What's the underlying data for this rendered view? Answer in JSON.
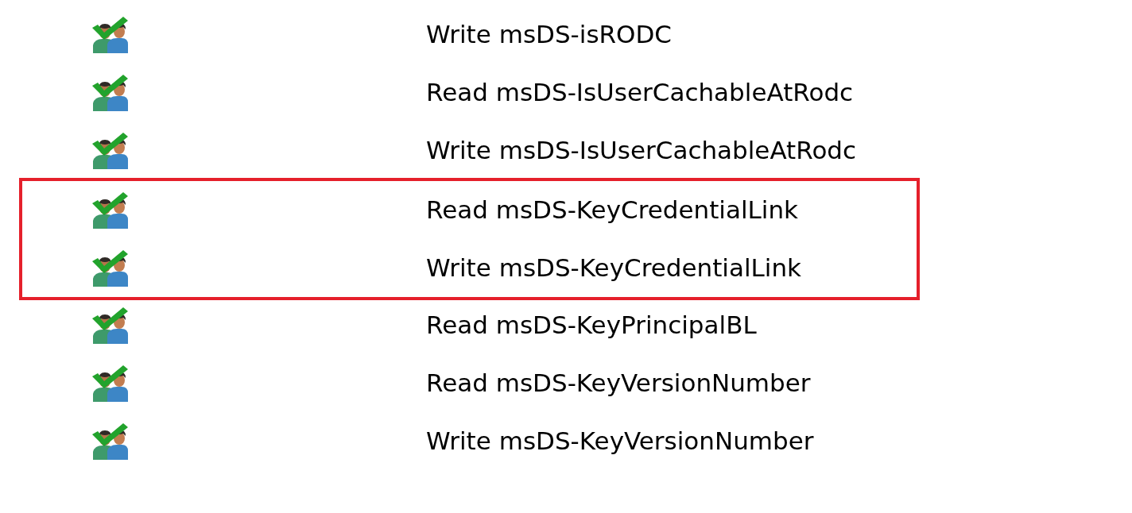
{
  "rows": [
    {
      "label": "Write msDS-isRODC",
      "highlighted": false
    },
    {
      "label": "Read msDS-IsUserCachableAtRodc",
      "highlighted": false
    },
    {
      "label": "Write msDS-IsUserCachableAtRodc",
      "highlighted": false
    },
    {
      "label": "Read msDS-KeyCredentialLink",
      "highlighted": true
    },
    {
      "label": "Write msDS-KeyCredentialLink",
      "highlighted": true
    },
    {
      "label": "Read msDS-KeyPrincipalBL",
      "highlighted": false
    },
    {
      "label": "Read msDS-KeyVersionNumber",
      "highlighted": false
    },
    {
      "label": "Write msDS-KeyVersionNumber",
      "highlighted": false
    }
  ]
}
